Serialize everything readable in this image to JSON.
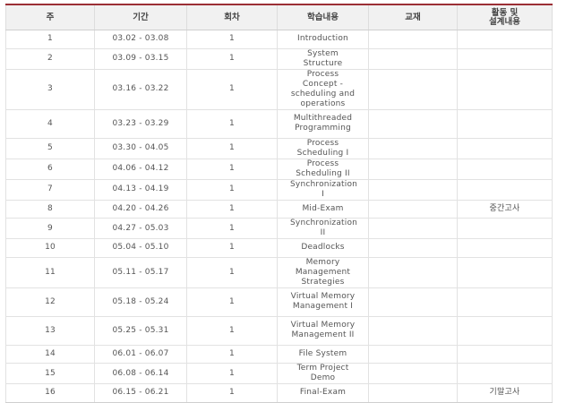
{
  "headers": [
    "주",
    "기간",
    "회차",
    "학습내용",
    "교재",
    "활동 및\n설계내용"
  ],
  "rows": [
    {
      "week": "1",
      "period": "03.02 - 03.08",
      "session": "1",
      "content": "Introduction",
      "textbook": "",
      "activity": "",
      "h": "h1"
    },
    {
      "week": "2",
      "period": "03.09 - 03.15",
      "session": "1",
      "content": "System  Structure",
      "textbook": "",
      "activity": "",
      "h": "h1"
    },
    {
      "week": "3",
      "period": "03.16 - 03.22",
      "session": "1",
      "content": "Process Concept - scheduling and operations",
      "textbook": "",
      "activity": "",
      "h": "h3"
    },
    {
      "week": "4",
      "period": "03.23 - 03.29",
      "session": "1",
      "content": "Multithreaded Programming",
      "textbook": "",
      "activity": "",
      "h": "h2"
    },
    {
      "week": "5",
      "period": "03.30 - 04.05",
      "session": "1",
      "content": "Process Scheduling I",
      "textbook": "",
      "activity": "",
      "h": "h1"
    },
    {
      "week": "6",
      "period": "04.06 - 04.12",
      "session": "1",
      "content": "Process Scheduling II",
      "textbook": "",
      "activity": "",
      "h": "h1"
    },
    {
      "week": "7",
      "period": "04.13 - 04.19",
      "session": "1",
      "content": "Synchronization I",
      "textbook": "",
      "activity": "",
      "h": "h1"
    },
    {
      "week": "8",
      "period": "04.20 - 04.26",
      "session": "1",
      "content": "Mid-Exam",
      "textbook": "",
      "activity": "중간고사",
      "h": "h1"
    },
    {
      "week": "9",
      "period": "04.27 - 05.03",
      "session": "1",
      "content": "Synchronization II",
      "textbook": "",
      "activity": "",
      "h": "h1"
    },
    {
      "week": "10",
      "period": "05.04 - 05.10",
      "session": "1",
      "content": "Deadlocks",
      "textbook": "",
      "activity": "",
      "h": "h1"
    },
    {
      "week": "11",
      "period": "05.11 - 05.17",
      "session": "1",
      "content": "Memory Management Strategies",
      "textbook": "",
      "activity": "",
      "h": "h2"
    },
    {
      "week": "12",
      "period": "05.18 - 05.24",
      "session": "1",
      "content": "Virtual Memory Management I",
      "textbook": "",
      "activity": "",
      "h": "h2"
    },
    {
      "week": "13",
      "period": "05.25 - 05.31",
      "session": "1",
      "content": "Virtual Memory Management II",
      "textbook": "",
      "activity": "",
      "h": "h2"
    },
    {
      "week": "14",
      "period": "06.01 - 06.07",
      "session": "1",
      "content": "File System",
      "textbook": "",
      "activity": "",
      "h": "h1"
    },
    {
      "week": "15",
      "period": "06.08 - 06.14",
      "session": "1",
      "content": "Term Project Demo",
      "textbook": "",
      "activity": "",
      "h": "h1"
    },
    {
      "week": "16",
      "period": "06.15 - 06.21",
      "session": "1",
      "content": "Final-Exam",
      "textbook": "",
      "activity": "기말고사",
      "h": "h1"
    }
  ]
}
